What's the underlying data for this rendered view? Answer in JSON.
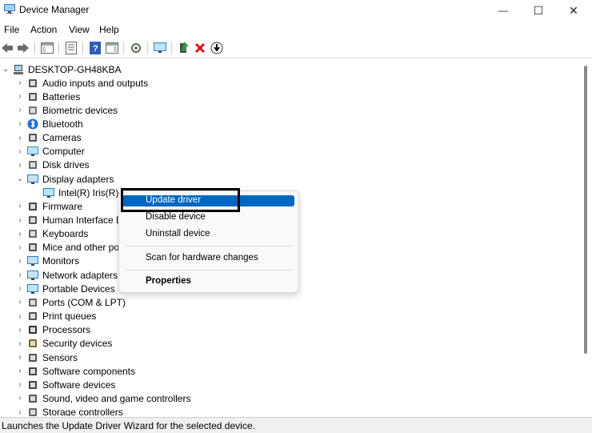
{
  "window": {
    "title": "Device Manager",
    "minimize_glyph": "—",
    "maximize_glyph": "☐",
    "close_glyph": "✕"
  },
  "menu": [
    "File",
    "Action",
    "View",
    "Help"
  ],
  "toolbar_icons": [
    "back-arrow-icon",
    "forward-arrow-icon",
    "show-hide-console-tree-icon",
    "properties-icon",
    "help-icon",
    "action-pane-icon",
    "scan-hardware-icon",
    "monitor-icon",
    "update-driver-icon",
    "uninstall-icon",
    "download-icon"
  ],
  "tree": {
    "root": "DESKTOP-GH48KBA",
    "categories": [
      "Audio inputs and outputs",
      "Batteries",
      "Biometric devices",
      "Bluetooth",
      "Cameras",
      "Computer",
      "Disk drives",
      "Display adapters",
      "Firmware",
      "Human Interface D",
      "Keyboards",
      "Mice and other po",
      "Monitors",
      "Network adapters",
      "Portable Devices",
      "Ports (COM & LPT)",
      "Print queues",
      "Processors",
      "Security devices",
      "Sensors",
      "Software components",
      "Software devices",
      "Sound, video and game controllers",
      "Storage controllers"
    ],
    "selected_device": "Intel(R) Iris(R) X"
  },
  "context_menu": {
    "update": "Update driver",
    "disable": "Disable device",
    "uninstall": "Uninstall device",
    "scan": "Scan for hardware changes",
    "properties": "Properties"
  },
  "status": "Launches the Update Driver Wizard for the selected device.",
  "colors": {
    "highlight": "#0067c0",
    "annotation_box": "#000000"
  }
}
